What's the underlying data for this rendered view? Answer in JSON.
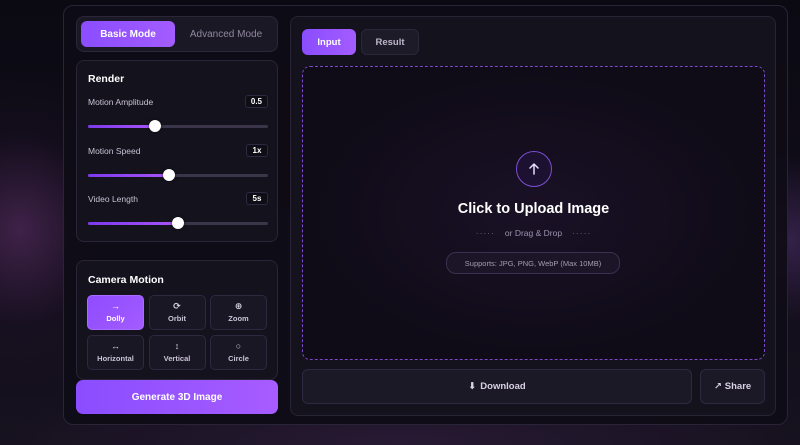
{
  "modes": {
    "basic": "Basic Mode",
    "advanced": "Advanced Mode"
  },
  "render": {
    "title": "Render",
    "sliders": [
      {
        "label": "Motion Amplitude",
        "value": "0.5",
        "fill_fraction": 0.37
      },
      {
        "label": "Motion Speed",
        "value": "1x",
        "fill_fraction": 0.45
      },
      {
        "label": "Video Length",
        "value": "5s",
        "fill_fraction": 0.5
      }
    ]
  },
  "camera": {
    "title": "Camera Motion",
    "options": [
      {
        "label": "Dolly",
        "icon": "→",
        "icon_name": "arrow-right-icon",
        "active": true
      },
      {
        "label": "Orbit",
        "icon": "⟳",
        "icon_name": "orbit-icon",
        "active": false
      },
      {
        "label": "Zoom",
        "icon": "⊕",
        "icon_name": "zoom-icon",
        "active": false
      },
      {
        "label": "Horizontal",
        "icon": "↔",
        "icon_name": "horizontal-arrows-icon",
        "active": false
      },
      {
        "label": "Vertical",
        "icon": "↕",
        "icon_name": "vertical-arrows-icon",
        "active": false
      },
      {
        "label": "Circle",
        "icon": "○",
        "icon_name": "circle-icon",
        "active": false
      }
    ]
  },
  "generate_label": "Generate 3D Image",
  "tabs": {
    "input": "Input",
    "result": "Result"
  },
  "upload": {
    "title": "Click to Upload Image",
    "subtitle": "or Drag & Drop",
    "supports": "Supports: JPG, PNG, WebP (Max 10MB)"
  },
  "download_label": "Download",
  "share_label": "Share",
  "colors": {
    "accent": "#8b4dff",
    "accent_light": "#a35cff",
    "panel": "#14121d"
  }
}
